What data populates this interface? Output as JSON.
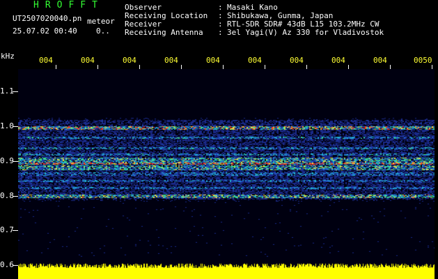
{
  "header": {
    "program_name": "HROFFT",
    "filename": "UT2507020040.pn",
    "meteor_label": "meteor",
    "datetime": "25.07.02 00:40",
    "count": "0.."
  },
  "info": [
    {
      "label": "Observer",
      "value": "Masaki Kano"
    },
    {
      "label": "Receiving Location",
      "value": "Shibukawa, Gunma, Japan"
    },
    {
      "label": "Receiver",
      "value": "RTL-SDR SDR# 43dB L15 103.2MHz CW"
    },
    {
      "label": "Receiving Antenna",
      "value": "3el Yagi(V) Az 330 for Vladivostok"
    }
  ],
  "separator": ":",
  "axis": {
    "unit": "kHz",
    "time_ticks": [
      "004",
      "004",
      "004",
      "004",
      "004",
      "004",
      "004",
      "004",
      "004",
      "0050"
    ],
    "freq_labels": [
      "1.1",
      "1.0",
      "0.9",
      "0.8",
      "0.7",
      "0.6"
    ]
  },
  "colors": {
    "title_green": "#33ff33",
    "tick_yellow": "#ffff33",
    "signal_yellow": "#ffff00",
    "noise_blue": "#1a2a9a",
    "background": "#000000"
  }
}
